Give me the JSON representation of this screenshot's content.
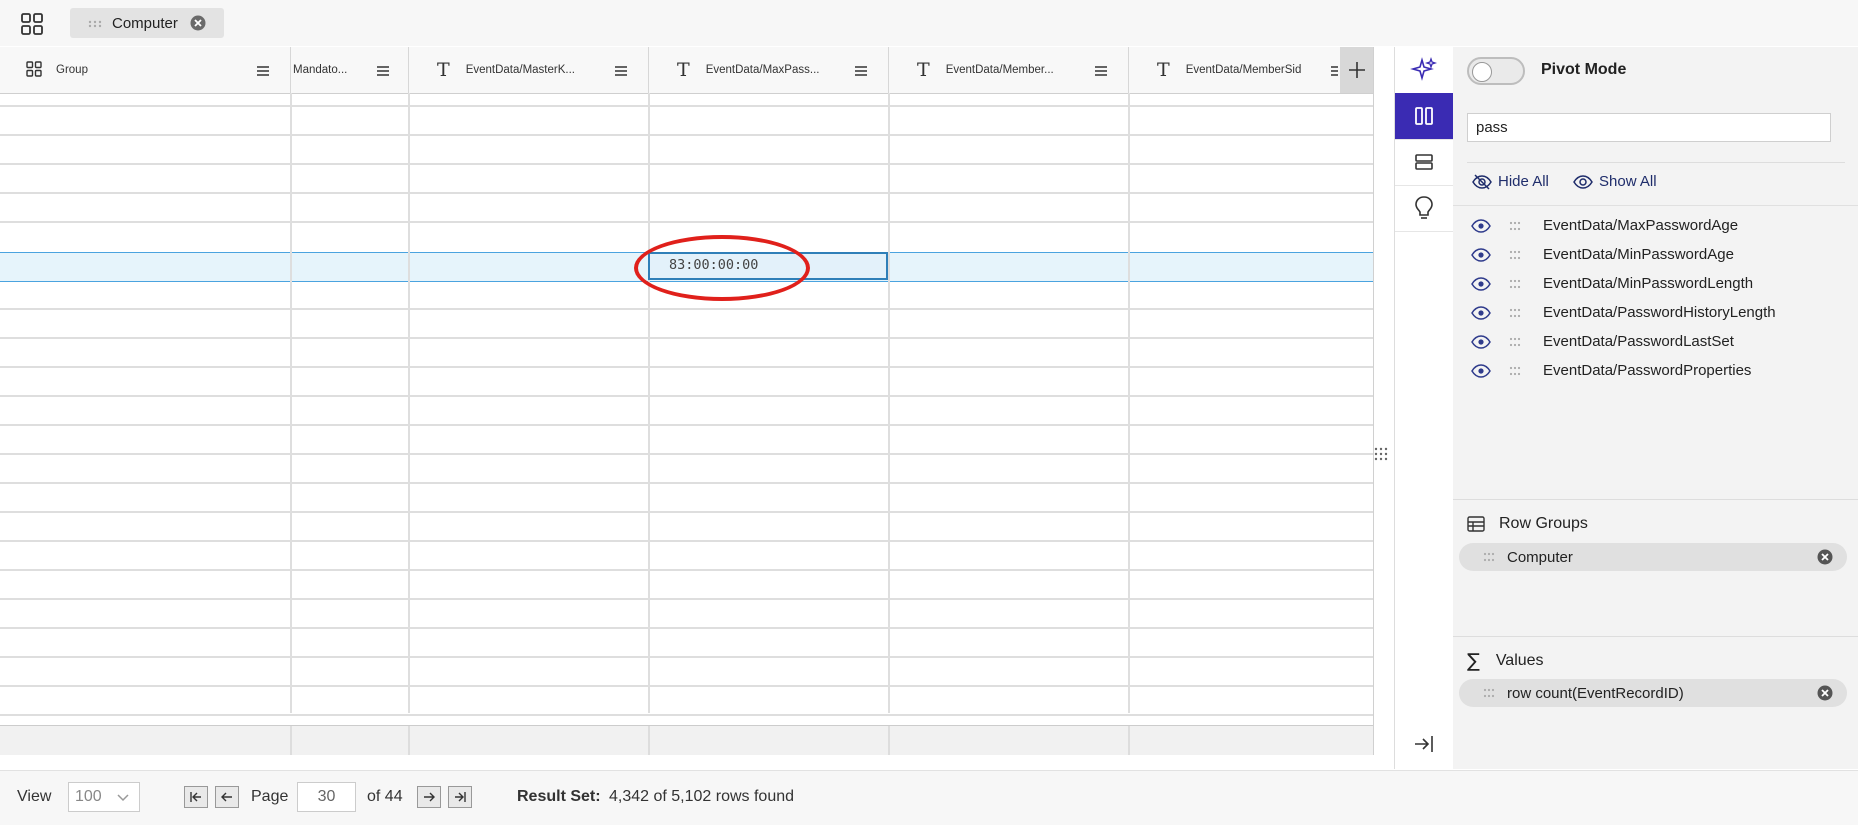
{
  "topbar": {
    "group_chip_label": "Computer"
  },
  "grid": {
    "columns": [
      {
        "label": "Group"
      },
      {
        "label": "Mandato..."
      },
      {
        "label": "EventData/MasterK..."
      },
      {
        "label": "EventData/MaxPass..."
      },
      {
        "label": "EventData/Member..."
      },
      {
        "label": "EventData/MemberSid"
      }
    ],
    "selected_cell_value": "83:00:00:00"
  },
  "tool_panel": {
    "pivot_mode_label": "Pivot Mode",
    "pivot_mode_on": false,
    "search_value": "pass",
    "hide_all_label": "Hide All",
    "show_all_label": "Show All",
    "columns": [
      "EventData/MaxPasswordAge",
      "EventData/MinPasswordAge",
      "EventData/MinPasswordLength",
      "EventData/PasswordHistoryLength",
      "EventData/PasswordLastSet",
      "EventData/PasswordProperties"
    ],
    "row_groups_label": "Row Groups",
    "row_groups": [
      "Computer"
    ],
    "values_label": "Values",
    "values": [
      "row count(EventRecordID)"
    ]
  },
  "bottombar": {
    "view_label": "View",
    "view_value": "100",
    "page_label": "Page",
    "page_value": "30",
    "of_label": "of 44",
    "result_label": "Result Set:",
    "result_value": "4,342 of 5,102 rows found"
  },
  "colors": {
    "accent": "#3a2bb3",
    "selection": "#e6f4fb",
    "highlight_ring": "#e0201b",
    "link": "#1f2d6b"
  }
}
